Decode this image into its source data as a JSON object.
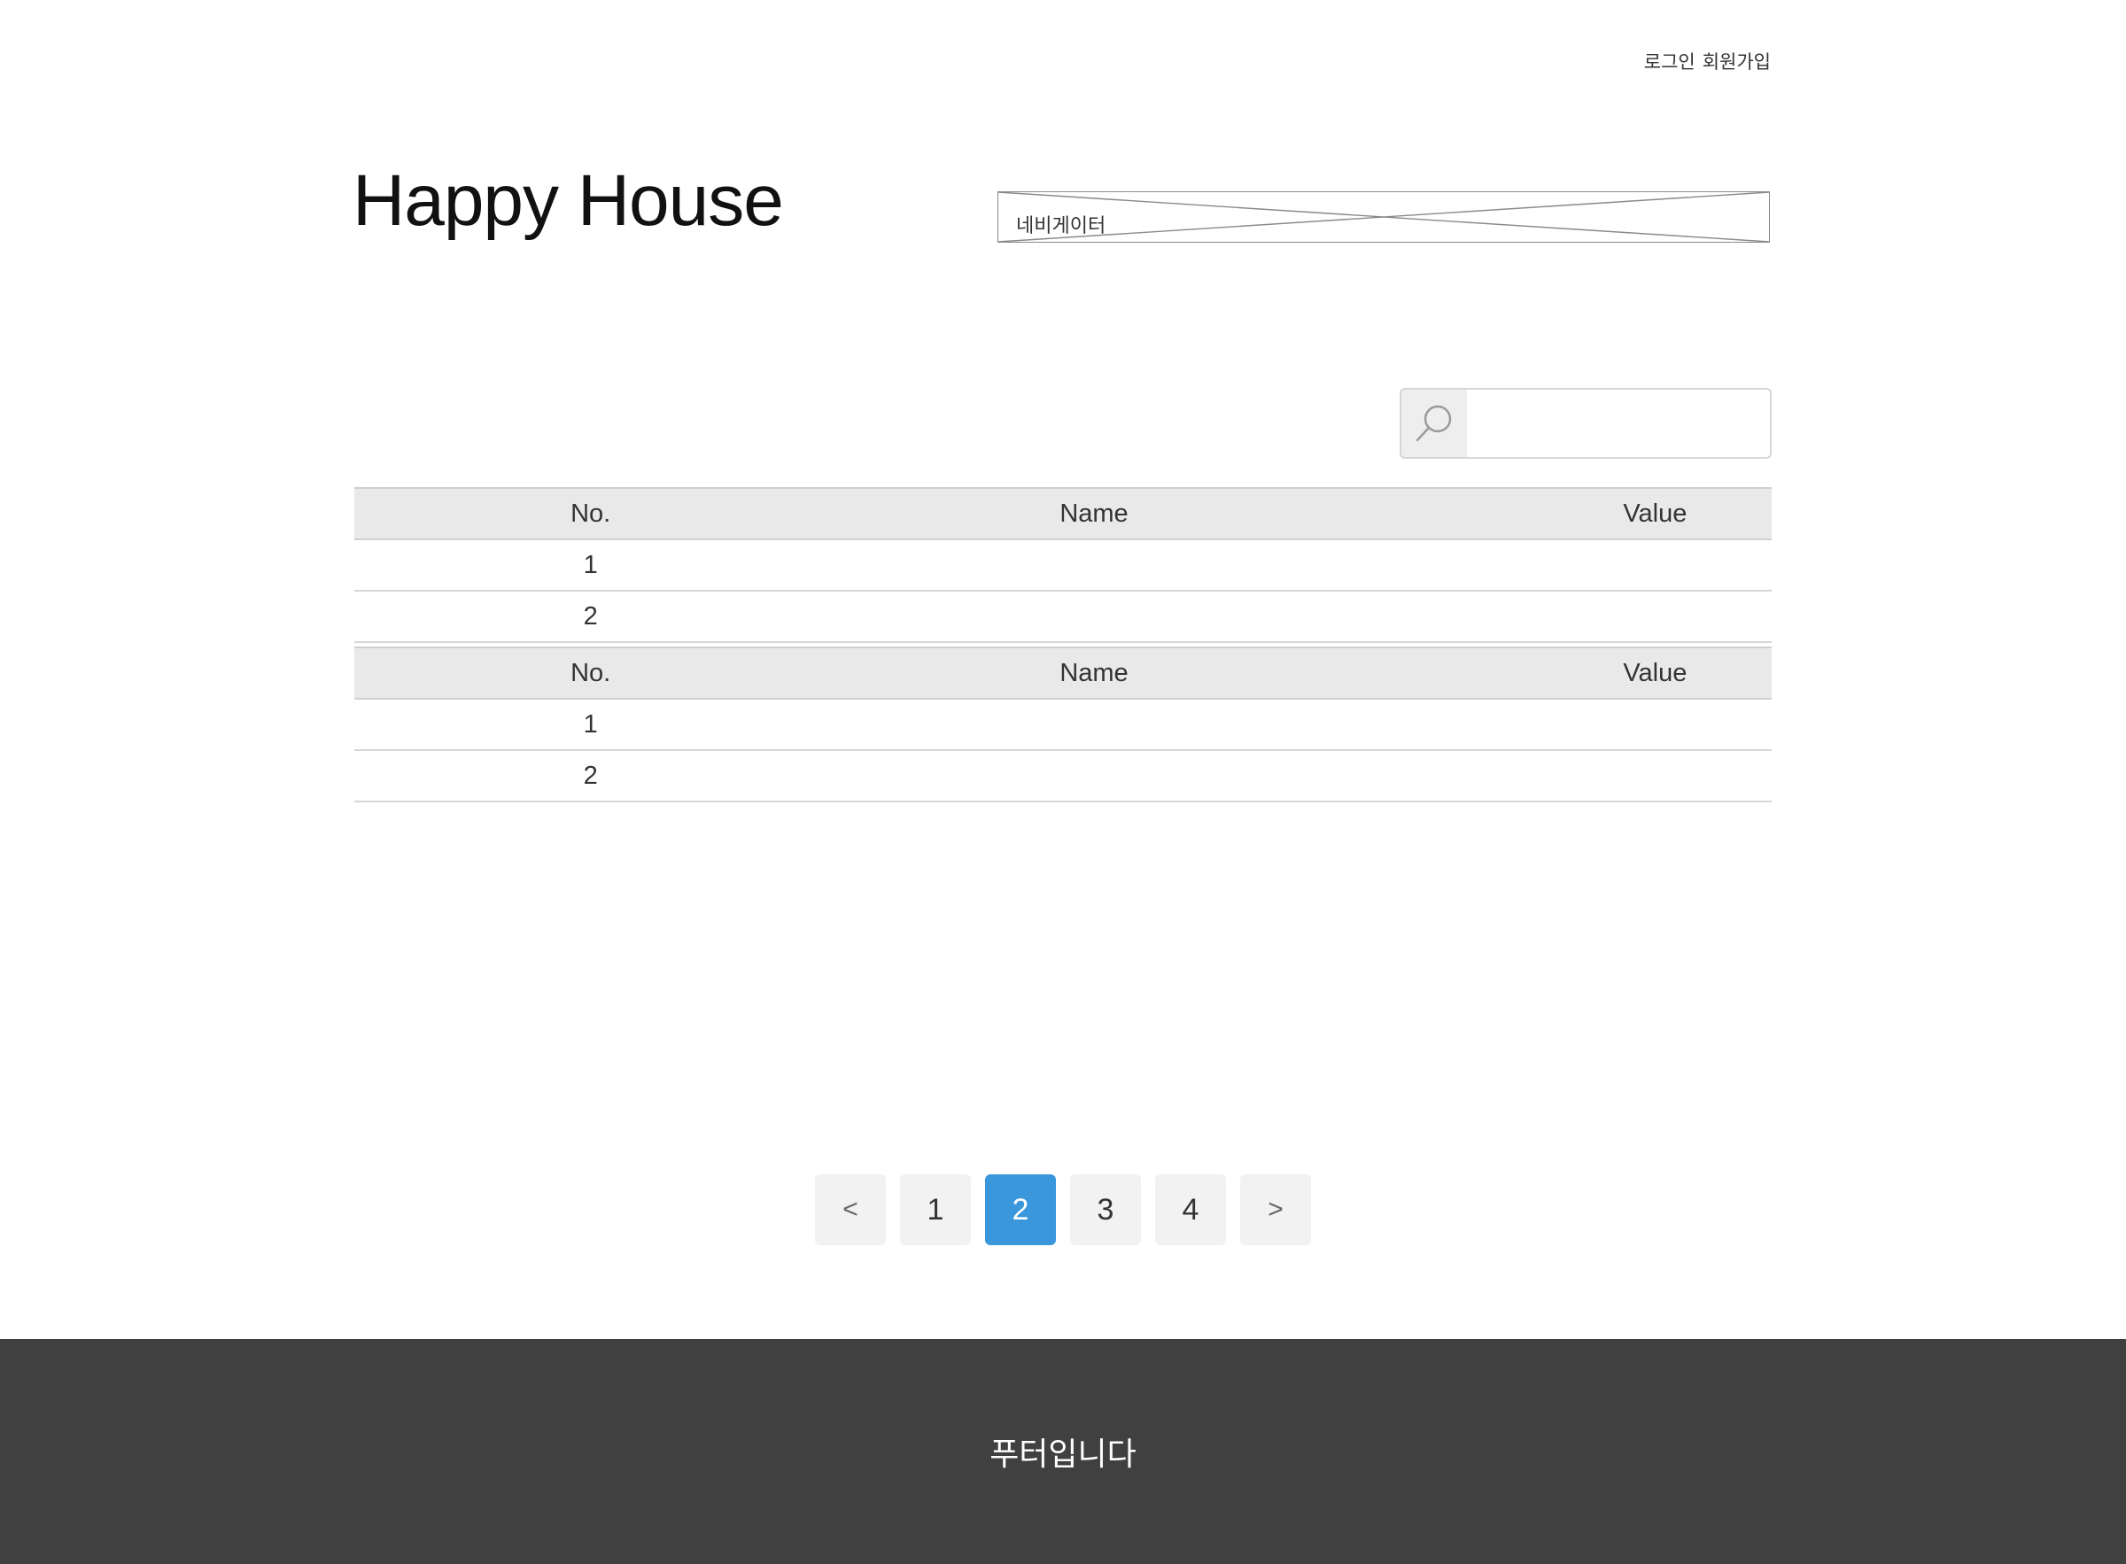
{
  "header": {
    "login_label": "로그인",
    "signup_label": "회원가입",
    "site_title": "Happy House",
    "nav_placeholder_label": "네비게이터"
  },
  "search": {
    "placeholder": "",
    "icon": "search-icon"
  },
  "tables": [
    {
      "columns": [
        "No.",
        "Name",
        "Value"
      ],
      "rows": [
        {
          "no": "1",
          "name": "",
          "value": ""
        },
        {
          "no": "2",
          "name": "",
          "value": ""
        }
      ]
    },
    {
      "columns": [
        "No.",
        "Name",
        "Value"
      ],
      "rows": [
        {
          "no": "1",
          "name": "",
          "value": ""
        },
        {
          "no": "2",
          "name": "",
          "value": ""
        }
      ]
    }
  ],
  "pagination": {
    "prev_label": "<",
    "next_label": ">",
    "pages": [
      "1",
      "2",
      "3",
      "4"
    ],
    "current_page": "2",
    "active_color": "#3a97dc"
  },
  "footer": {
    "text": "푸터입니다",
    "background": "#404040"
  }
}
